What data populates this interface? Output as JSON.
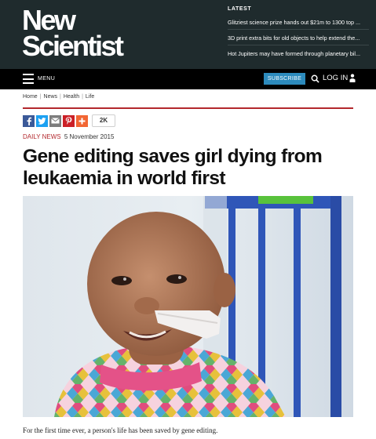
{
  "header": {
    "logo_line1": "New",
    "logo_line2": "Scientist",
    "latest_title": "LATEST",
    "latest_items": [
      "Glitziest science prize hands out $21m to 1300 top ...",
      "3D print extra bits for old objects to help extend the...",
      "Hot Jupiters may have formed through planetary bil..."
    ]
  },
  "nav": {
    "menu_label": "MENU",
    "subscribe_label": "SUBSCRIBE",
    "login_label": "LOG IN",
    "icons": [
      "hamburger-icon",
      "search-icon",
      "user-icon"
    ]
  },
  "breadcrumb": {
    "items": [
      "Home",
      "News",
      "Health",
      "Life"
    ]
  },
  "share": {
    "buttons": [
      "facebook-icon",
      "twitter-icon",
      "email-icon",
      "pinterest-icon",
      "plus-icon"
    ],
    "count": "2K",
    "colors": {
      "facebook": "#3b5998",
      "twitter": "#1da1f2",
      "email": "#7d7d7d",
      "pinterest": "#cb2027",
      "plus": "#f26633"
    }
  },
  "article": {
    "section": "DAILY NEWS",
    "date": "5 November 2015",
    "headline": "Gene editing saves girl dying from leukaemia in world first",
    "intro": "For the first time ever, a person's life has been saved by gene editing."
  },
  "theme": {
    "header_bg": "#1f2b2d",
    "accent_red": "#b3282d",
    "subscribe_blue": "#2d8bbd"
  }
}
